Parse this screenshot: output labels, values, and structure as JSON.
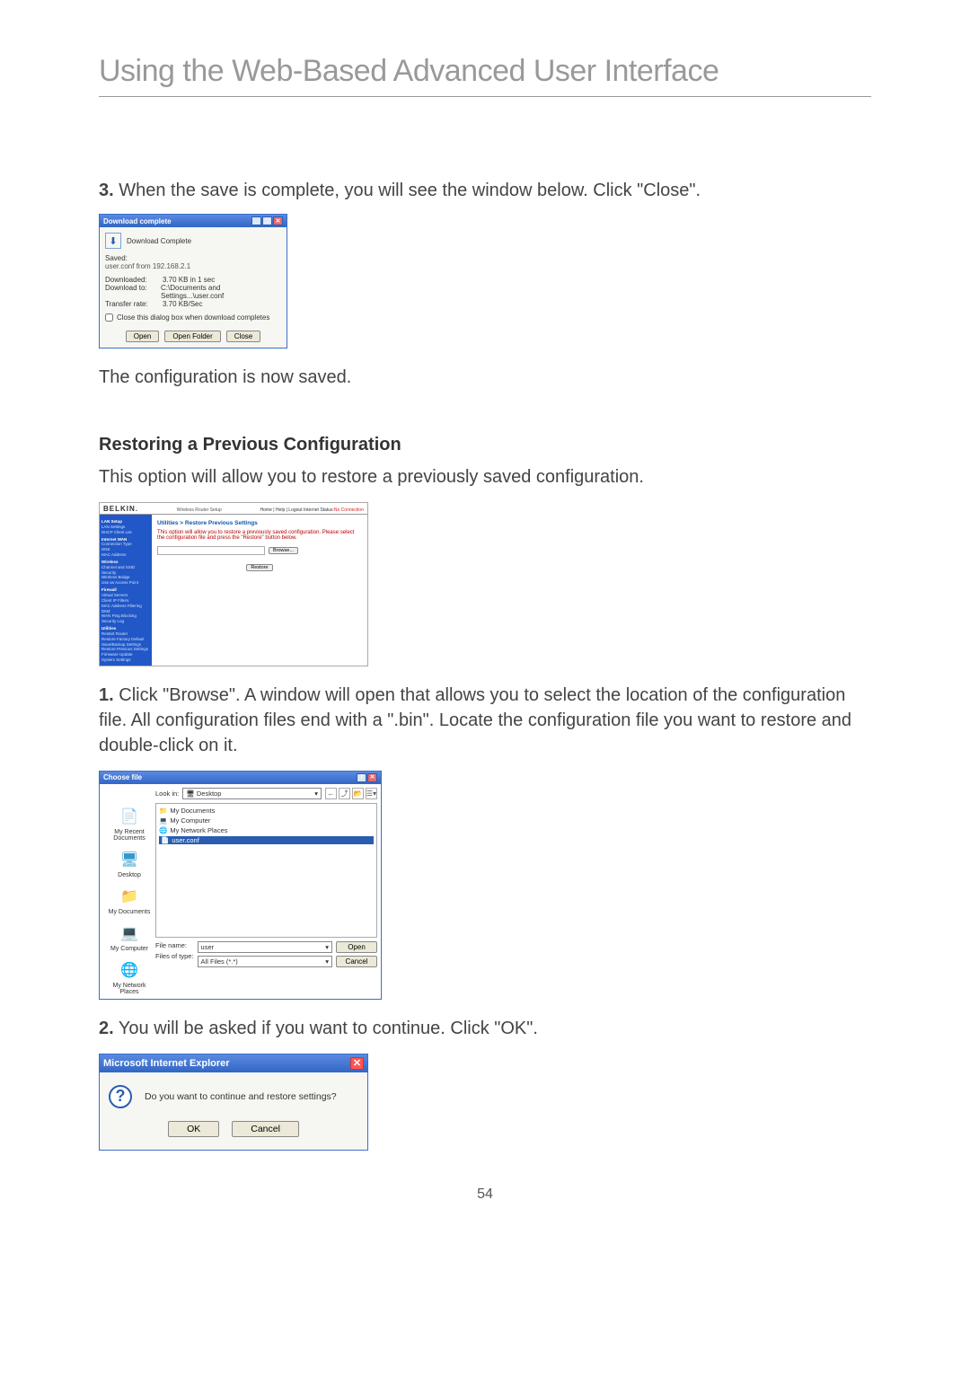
{
  "page": {
    "title": "Using the Web-Based Advanced User Interface",
    "step3": "When the save is complete, you will see the window below. Click \"Close\".",
    "config_saved": "The configuration is now saved.",
    "restore_heading": "Restoring a Previous Configuration",
    "restore_intro": "This option will allow you to restore a previously saved configuration.",
    "step1": "Click \"Browse\". A window will open that allows you to select the location of the configuration file. All configuration files end with a \".bin\". Locate the configuration file you want to restore and double-click on it.",
    "step2": "You will be asked if you want to continue. Click \"OK\".",
    "number": "54"
  },
  "download_dialog": {
    "title": "Download complete",
    "header": "Download Complete",
    "saved_label": "Saved:",
    "saved_value": "user.conf from 192.168.2.1",
    "rows": {
      "downloaded_label": "Downloaded:",
      "downloaded_value": "3.70 KB in 1 sec",
      "to_label": "Download to:",
      "to_value": "C:\\Documents and Settings...\\user.conf",
      "rate_label": "Transfer rate:",
      "rate_value": "3.70 KB/Sec"
    },
    "checkbox": "Close this dialog box when download completes",
    "buttons": {
      "open": "Open",
      "open_folder": "Open Folder",
      "close": "Close"
    }
  },
  "belkin": {
    "logo": "BELKIN.",
    "model": "Wireless Router Setup",
    "top_links": "Home | Help | Logout    Internet Status:",
    "top_status": "No Connection",
    "main_heading": "Utilities > Restore Previous Settings",
    "main_text": "This option will allow you to restore a previously saved configuration. Please select the configuration file and press the \"Restore\" button below.",
    "browse": "Browse...",
    "restore": "Restore",
    "sidebar": {
      "g1": "LAN Setup",
      "i1": "LAN Settings",
      "i2": "DHCP Client List",
      "g2": "Internet WAN",
      "i3": "Connection Type",
      "i4": "DNS",
      "i5": "MAC Address",
      "g3": "Wireless",
      "i6": "Channel and SSID",
      "i7": "Security",
      "i8": "Wireless Bridge",
      "i9": "Use as Access Point",
      "g4": "Firewall",
      "i10": "Virtual Servers",
      "i11": "Client IP Filters",
      "i12": "MAC Address Filtering",
      "i13": "DMZ",
      "i14": "WAN Ping Blocking",
      "i15": "Security Log",
      "g5": "Utilities",
      "i16": "Restart Router",
      "i17": "Restore Factory Default",
      "i18": "Save/Backup Settings",
      "i19": "Restore Previous Settings",
      "i20": "Firmware Update",
      "i21": "System Settings"
    }
  },
  "choose": {
    "title": "Choose file",
    "lookin_label": "Look in:",
    "lookin_value": "Desktop",
    "side": {
      "recent": "My Recent Documents",
      "desktop": "Desktop",
      "docs": "My Documents",
      "computer": "My Computer",
      "network": "My Network Places"
    },
    "files": {
      "f1": "My Documents",
      "f2": "My Computer",
      "f3": "My Network Places",
      "f4": "user.conf"
    },
    "filename_label": "File name:",
    "filename_value": "user",
    "filetype_label": "Files of type:",
    "filetype_value": "All Files (*.*)",
    "open": "Open",
    "cancel": "Cancel"
  },
  "ie": {
    "title": "Microsoft Internet Explorer",
    "message": "Do you want to continue and restore settings?",
    "ok": "OK",
    "cancel": "Cancel"
  }
}
